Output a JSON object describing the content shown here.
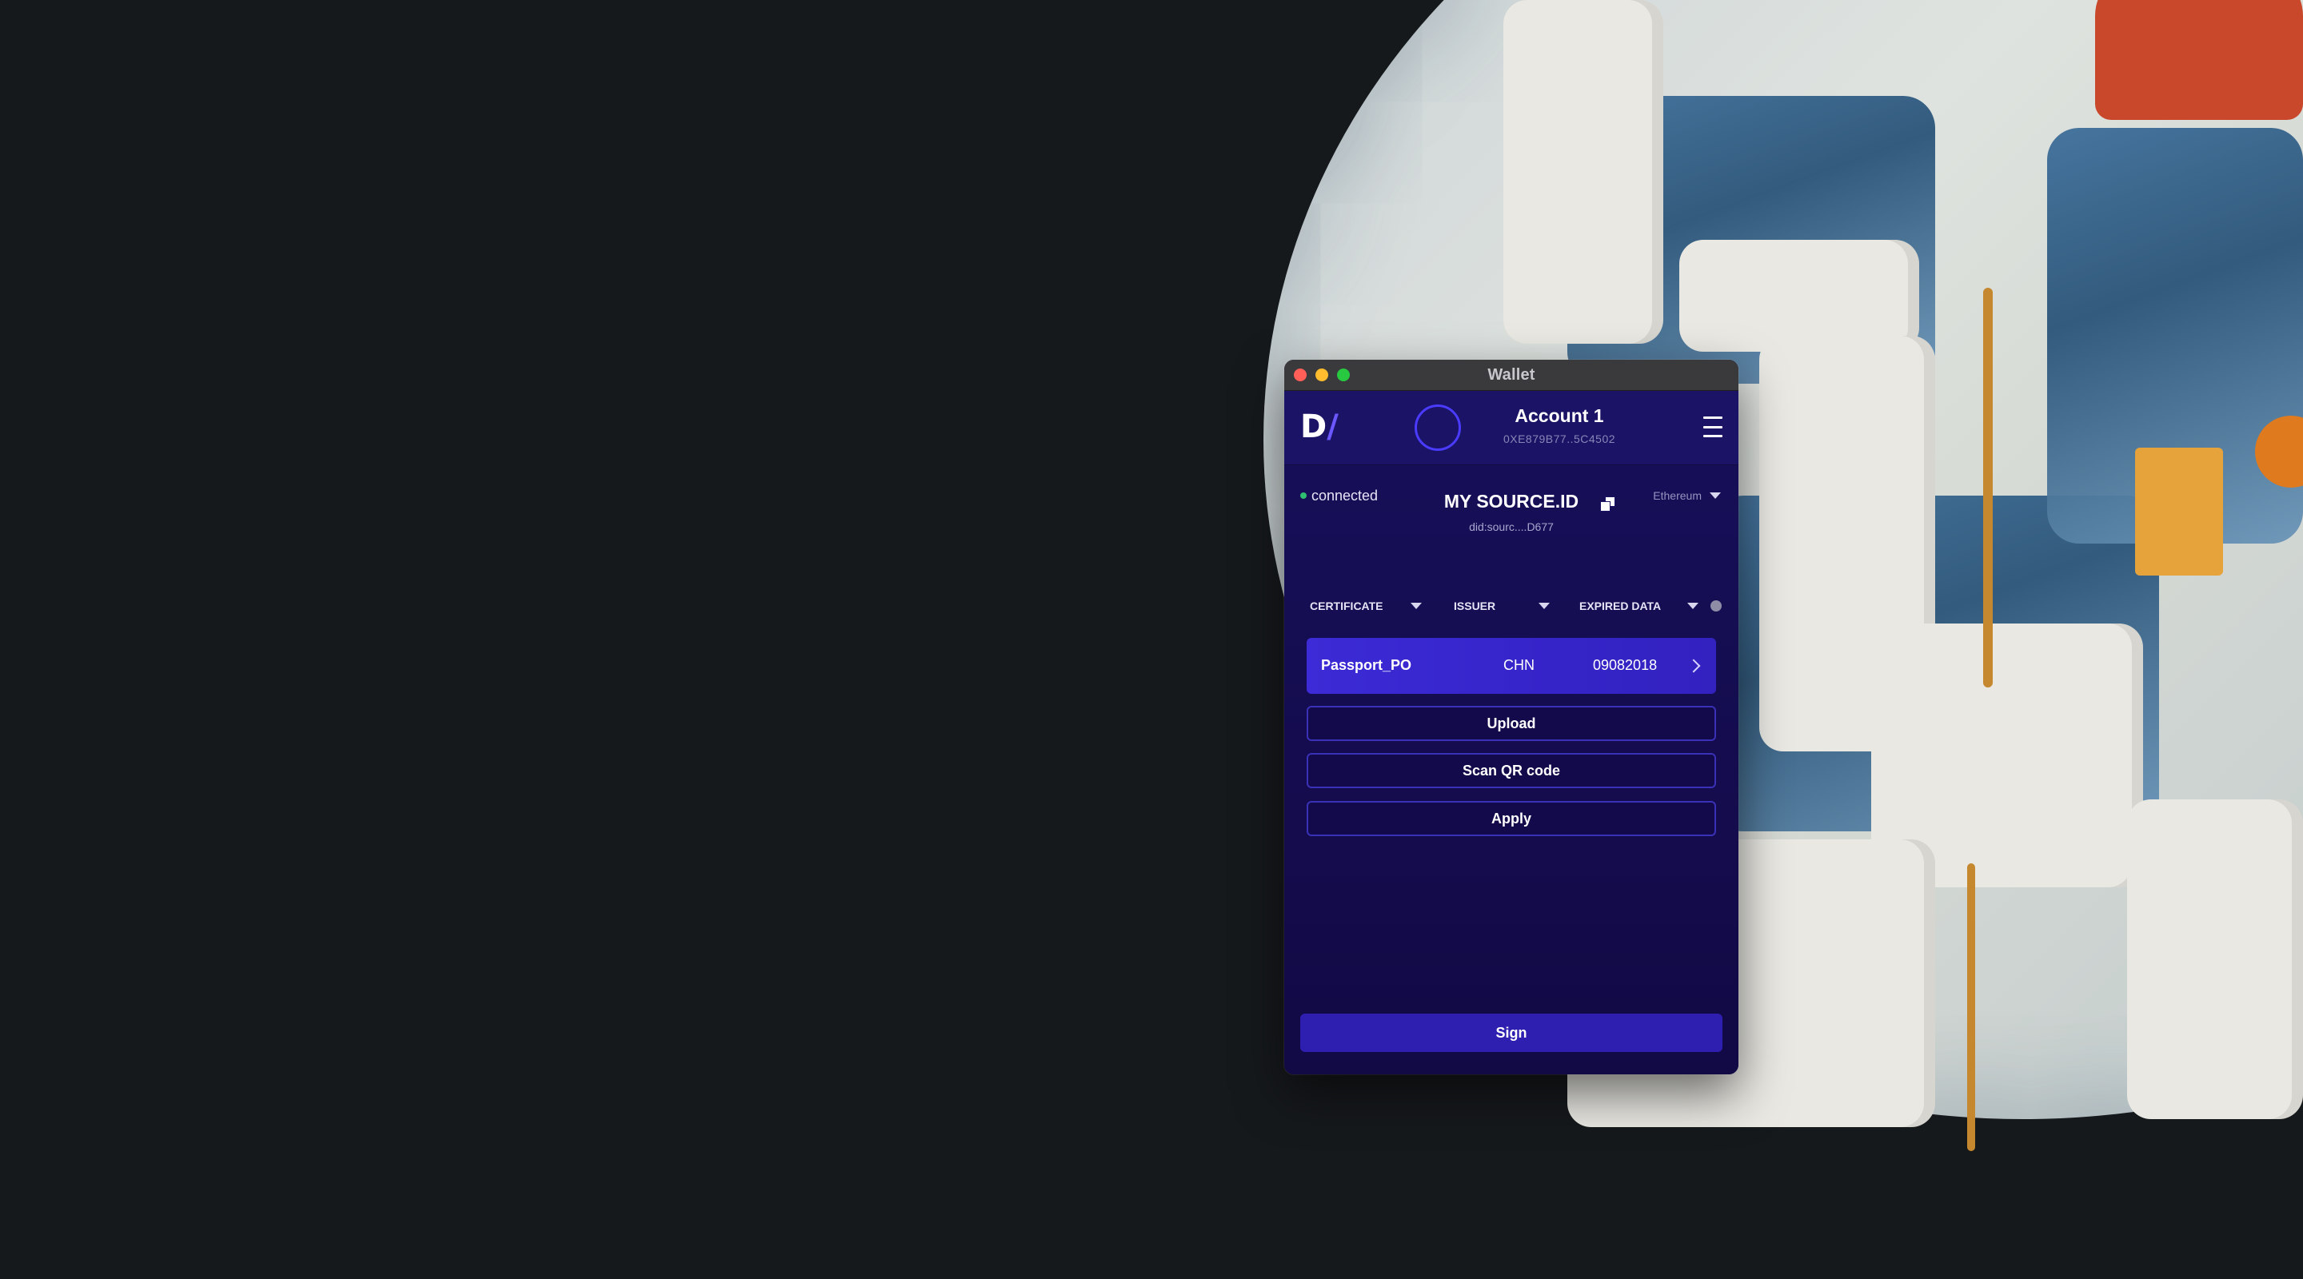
{
  "window": {
    "title": "Wallet"
  },
  "header": {
    "logo_letter": "D",
    "logo_slash": "/",
    "account_name": "Account 1",
    "account_address": "0XE879B77..5C4502"
  },
  "status": {
    "connection": "connected",
    "network": "Ethereum"
  },
  "identity": {
    "title": "MY SOURCE.ID",
    "did": "did:sourc....D677"
  },
  "filters": {
    "certificate": "CERTIFICATE",
    "issuer": "ISSUER",
    "expired": "EXPIRED DATA"
  },
  "documents": [
    {
      "name": "Passport_PO",
      "issuer": "CHN",
      "expired": "09082018"
    }
  ],
  "actions": {
    "upload": "Upload",
    "scan": "Scan QR code",
    "apply": "Apply",
    "sign": "Sign"
  },
  "colors": {
    "window_bg": "#140c4e",
    "header_bg": "#1a1366",
    "accent": "#3c2bd6",
    "connected": "#2fbf71",
    "desktop": "#16191c"
  }
}
